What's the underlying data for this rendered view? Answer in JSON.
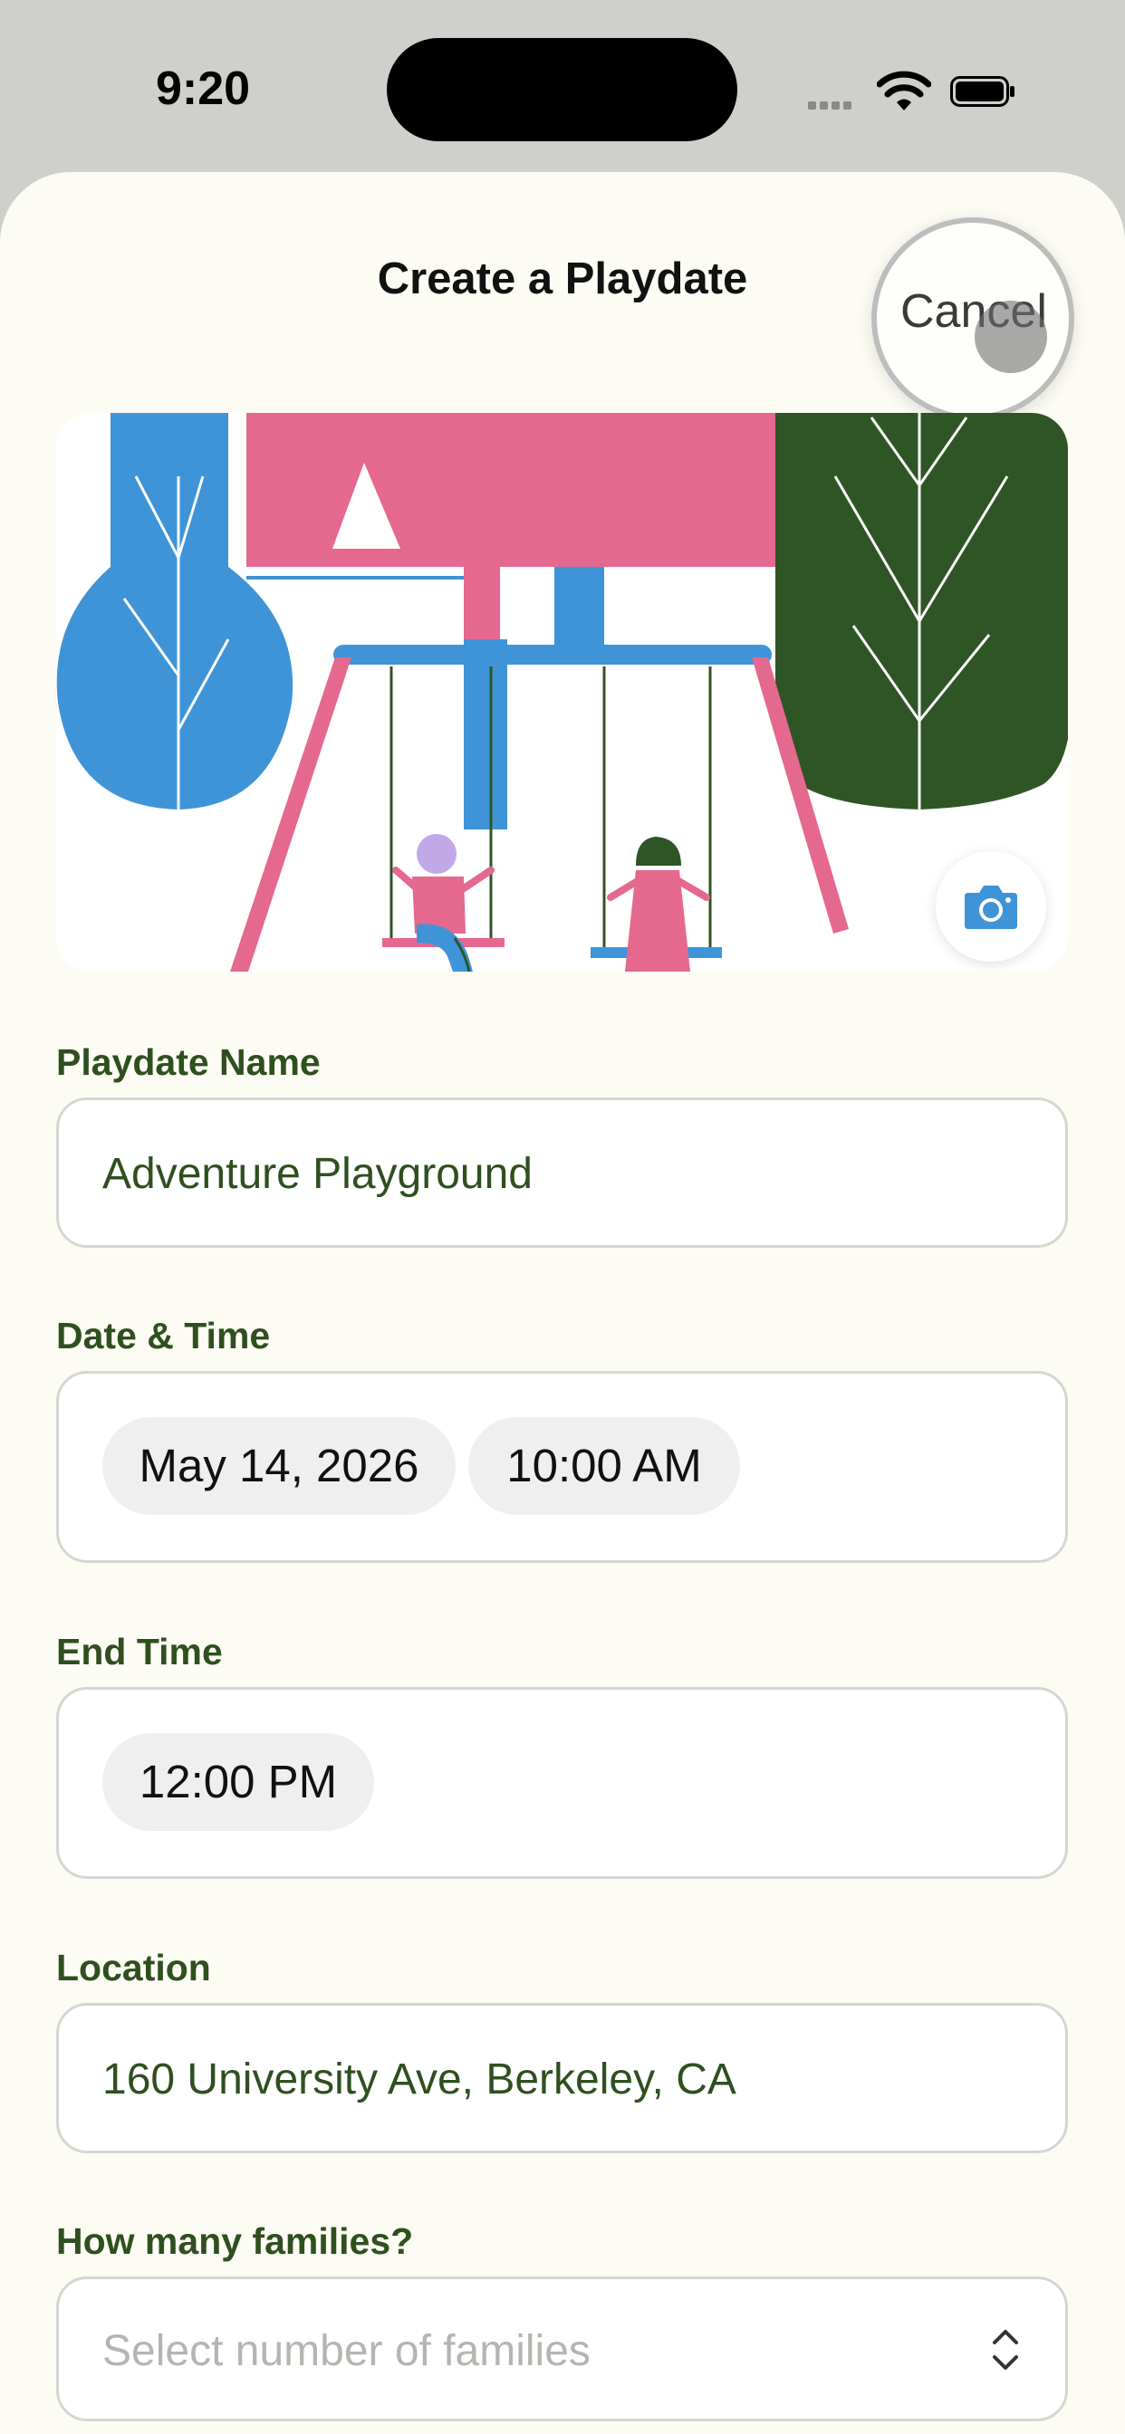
{
  "status_bar": {
    "time": "9:20"
  },
  "header": {
    "title": "Create a Playdate",
    "cancel_label": "Cancel"
  },
  "form": {
    "name": {
      "label": "Playdate Name",
      "value": "Adventure Playground"
    },
    "datetime": {
      "label": "Date & Time",
      "date": "May 14, 2026",
      "time": "10:00 AM"
    },
    "end_time": {
      "label": "End Time",
      "time": "12:00 PM"
    },
    "location": {
      "label": "Location",
      "value": "160 University Ave, Berkeley, CA"
    },
    "families": {
      "label": "How many families?",
      "placeholder": "Select number of families"
    }
  },
  "colors": {
    "sheet_bg": "#fdfcf4",
    "label_green": "#2f4f1f",
    "pink": "#e5688f",
    "blue": "#3e94d6",
    "dark_green": "#2f5426"
  },
  "icons": [
    "wifi-icon",
    "battery-icon",
    "camera-icon",
    "chevron-up-down-icon"
  ]
}
